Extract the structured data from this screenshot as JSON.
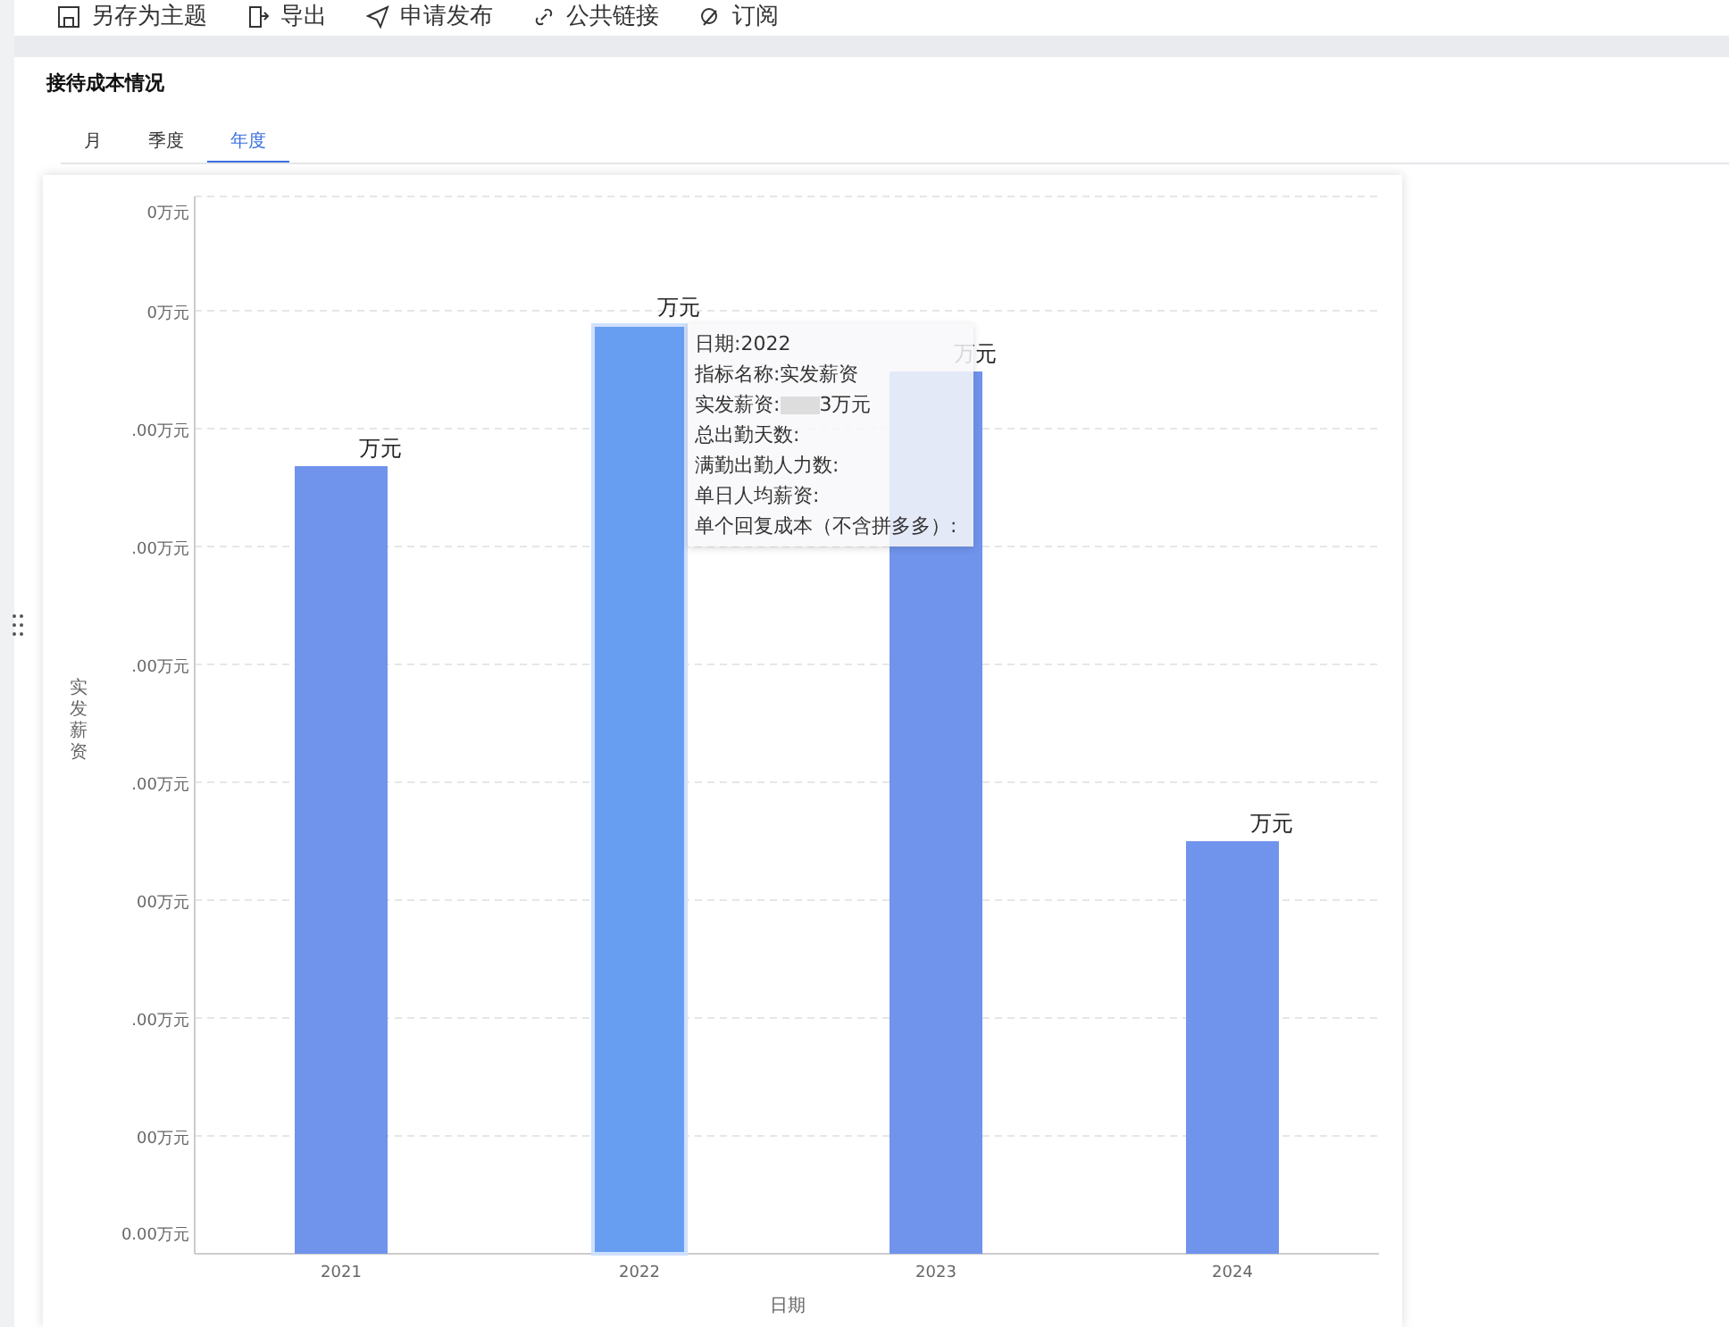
{
  "toolbar": [
    {
      "label": "另存为主题"
    },
    {
      "label": "导出"
    },
    {
      "label": "申请发布"
    },
    {
      "label": "公共链接"
    },
    {
      "label": "订阅"
    }
  ],
  "panel": {
    "title": "接待成本情况",
    "tabs": [
      {
        "label": "月",
        "selected": false
      },
      {
        "label": "季度",
        "selected": false
      },
      {
        "label": "年度",
        "selected": true
      }
    ],
    "chart": {
      "ylabel": "实发薪资",
      "xlabel": "日期",
      "yticks": [
        "0万元",
        "0万元",
        ".00万元",
        ".00万元",
        ".00万元",
        ".00万元",
        "00万元",
        ".00万元",
        "00万元",
        "0.00万元"
      ],
      "categories": [
        {
          "label": "2021",
          "selected": false
        },
        {
          "label": "2022",
          "selected": true
        },
        {
          "label": "2023",
          "selected": false
        },
        {
          "label": "2024",
          "selected": false
        }
      ],
      "data_labels": [
        "万元",
        "万元",
        "万元",
        "万元"
      ],
      "tooltip": {
        "lines": [
          "日期:2022",
          "指标名称:实发薪资",
          "实发薪资:",
          "总出勤天数:",
          "满勤出勤人力数:",
          "单日人均薪资:",
          "单个回复成本（不含拼多多）:"
        ],
        "value_suffix": "3万元"
      }
    }
  }
}
